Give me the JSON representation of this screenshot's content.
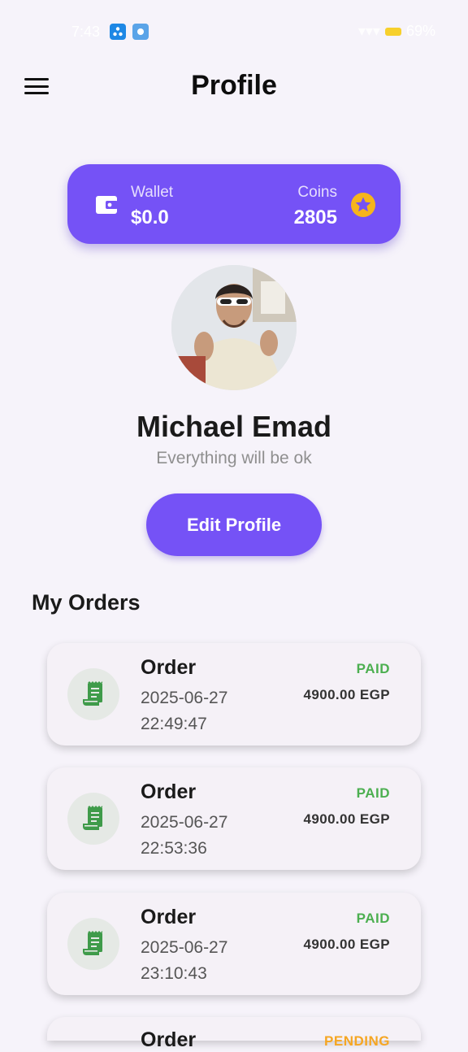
{
  "status_bar": {
    "time": "7:43",
    "signal_text": "… … … … 69%"
  },
  "header": {
    "title": "Profile",
    "menu_icon": "hamburger-menu-icon"
  },
  "wallet": {
    "wallet_label": "Wallet",
    "wallet_value": "$0.0",
    "coins_label": "Coins",
    "coins_value": "2805",
    "accent_color": "#7552f6",
    "star_color": "#f6b51b"
  },
  "profile": {
    "name": "Michael Emad",
    "bio": "Everything will be ok",
    "edit_label": "Edit Profile"
  },
  "orders": {
    "section_title": "My Orders",
    "items": [
      {
        "title": "Order",
        "date": "2025-06-27",
        "time": "22:49:47",
        "status": "PAID",
        "amount": "4900.00 EGP"
      },
      {
        "title": "Order",
        "date": "2025-06-27",
        "time": "22:53:36",
        "status": "PAID",
        "amount": "4900.00 EGP"
      },
      {
        "title": "Order",
        "date": "2025-06-27",
        "time": "23:10:43",
        "status": "PAID",
        "amount": "4900.00 EGP"
      },
      {
        "title": "Order",
        "date": "",
        "time": "",
        "status": "PENDING",
        "amount": ""
      }
    ],
    "paid_color": "#4caf50",
    "pending_color": "#f5a623",
    "icon": "receipt-icon"
  }
}
